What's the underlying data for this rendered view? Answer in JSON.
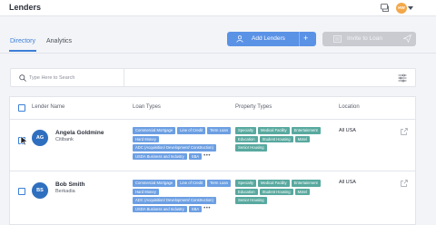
{
  "app": {
    "title": "Lenders",
    "user_initials": "HW"
  },
  "tabs": [
    {
      "label": "Directory",
      "active": true
    },
    {
      "label": "Analytics",
      "active": false
    }
  ],
  "actions": {
    "add_label": "Add Lenders",
    "add_plus": "+",
    "invite_label": "Invite to Loan"
  },
  "search": {
    "placeholder": "Type Here to Search",
    "value": ""
  },
  "table": {
    "headers": {
      "name": "Lender Name",
      "loan": "Loan Types",
      "property": "Property Types",
      "location": "Location"
    },
    "rows": [
      {
        "initials": "AG",
        "name": "Angela Goldmine",
        "company": "Citibank",
        "loan_tags": [
          "Commercial Mortgage",
          "Line of Credit",
          "Term Loan",
          "Hard Money",
          "ADC (Acquisition/ Development/ Construction)",
          "USDA Business and Industry",
          "SBA"
        ],
        "property_tags": [
          "Specialty",
          "Medical Facility",
          "Entertainment",
          "Education",
          "Student Housing",
          "Motel",
          "Senior Housing"
        ],
        "more": "•••",
        "location": "All USA"
      },
      {
        "initials": "BS",
        "name": "Bob Smith",
        "company": "Berkadia",
        "loan_tags": [
          "Commercial Mortgage",
          "Line of Credit",
          "Term Loan",
          "Hard Money",
          "ADC (Acquisition/ Development/ Construction)",
          "USDA Business and Industry",
          "SBA"
        ],
        "property_tags": [
          "Specialty",
          "Medical Facility",
          "Entertainment",
          "Education",
          "Student Housing",
          "Motel",
          "Senior Housing"
        ],
        "more": "•••",
        "location": "All USA"
      }
    ]
  },
  "colors": {
    "accent": "#3b7fd8",
    "primary_button": "#5a92e6",
    "loan_tag": "#6c9fe3",
    "property_tag": "#58a99f",
    "avatar": "#2f6fbf",
    "user_avatar": "#f3a84a"
  },
  "icons": {
    "chat": "chat-icon",
    "user": "add-user-icon",
    "invite": "invite-icon",
    "send": "send-icon",
    "search": "search-icon",
    "filter": "filter-icon",
    "share": "share-icon",
    "cursor": "cursor-pointer-icon"
  }
}
